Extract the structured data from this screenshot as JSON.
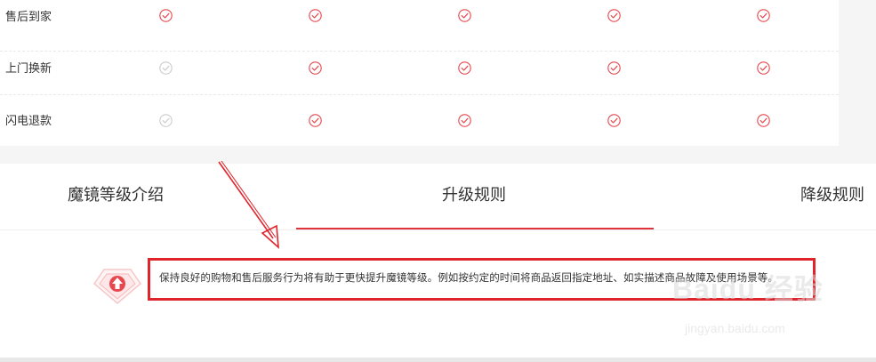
{
  "benefit_table": {
    "rows": [
      {
        "label": "售后到家",
        "checks": [
          "active",
          "active",
          "active",
          "active",
          "active"
        ]
      },
      {
        "label": "上门换新",
        "checks": [
          "inactive",
          "active",
          "active",
          "active",
          "active"
        ]
      },
      {
        "label": "闪电退款",
        "checks": [
          "inactive",
          "active",
          "active",
          "active",
          "active"
        ]
      }
    ]
  },
  "tabs": {
    "items": [
      {
        "label": "魔镜等级介绍"
      },
      {
        "label": "升级规则",
        "active": true
      },
      {
        "label": "降级规则"
      }
    ]
  },
  "notice": {
    "text": "保持良好的购物和售后服务行为将有助于更快提升魔镜等级。例如按约定的时间将商品返回指定地址、如实描述商品故障及使用场景等。",
    "icon": "up-arrow-diamond-icon"
  },
  "watermark": {
    "logo": "Baidu 经验",
    "url": "jingyan.baidu.com"
  },
  "colors": {
    "accent": "#e0333b",
    "highlight_box": "#e0242c",
    "check_active": "#e8474e",
    "check_inactive": "#cccccc"
  }
}
